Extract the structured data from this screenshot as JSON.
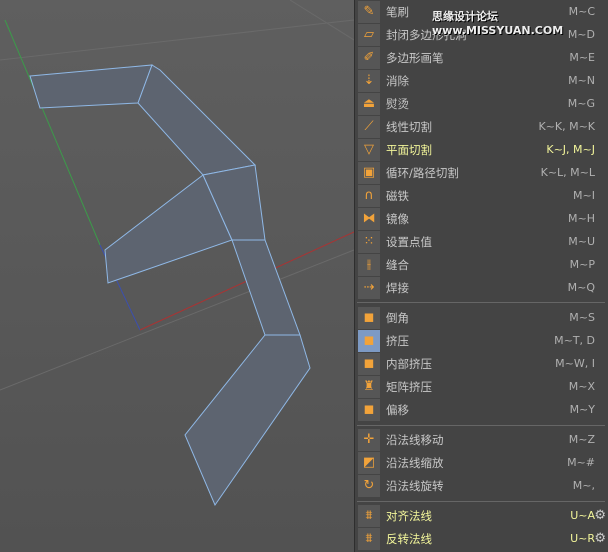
{
  "watermark": "思缘设计论坛 www.MISSYUAN.COM",
  "menu": {
    "group1": [
      {
        "icon": "brush-icon",
        "glyph": "✎",
        "label": "笔刷",
        "shortcut": "M~C"
      },
      {
        "icon": "close-polygon-hole-icon",
        "glyph": "▱",
        "label": "封闭多边形孔洞",
        "shortcut": "M~D"
      },
      {
        "icon": "polygon-pen-icon",
        "glyph": "✐",
        "label": "多边形画笔",
        "shortcut": "M~E"
      },
      {
        "icon": "dissolve-icon",
        "glyph": "⇣",
        "label": "消除",
        "shortcut": "M~N"
      },
      {
        "icon": "iron-icon",
        "glyph": "⏏",
        "label": "熨烫",
        "shortcut": "M~G"
      },
      {
        "icon": "knife-icon",
        "glyph": "⟋",
        "label": "线性切割",
        "shortcut": "K~K, M~K"
      },
      {
        "icon": "plane-cut-icon",
        "glyph": "▽",
        "label": "平面切割",
        "shortcut": "K~J, M~J",
        "highlight": true
      },
      {
        "icon": "loop-cut-icon",
        "glyph": "▣",
        "label": "循环/路径切割",
        "shortcut": "K~L, M~L"
      },
      {
        "icon": "magnet-icon",
        "glyph": "∩",
        "label": "磁铁",
        "shortcut": "M~I"
      },
      {
        "icon": "mirror-icon",
        "glyph": "⧓",
        "label": "镜像",
        "shortcut": "M~H"
      },
      {
        "icon": "set-point-value-icon",
        "glyph": "⁙",
        "label": "设置点值",
        "shortcut": "M~U"
      },
      {
        "icon": "stitch-icon",
        "glyph": "⫲",
        "label": "缝合",
        "shortcut": "M~P"
      },
      {
        "icon": "weld-icon",
        "glyph": "⇢",
        "label": "焊接",
        "shortcut": "M~Q"
      }
    ],
    "group2": [
      {
        "icon": "bevel-icon",
        "glyph": "◼",
        "label": "倒角",
        "shortcut": "M~S"
      },
      {
        "icon": "extrude-icon",
        "glyph": "◼",
        "label": "挤压",
        "shortcut": "M~T, D",
        "selected": true
      },
      {
        "icon": "inner-extrude-icon",
        "glyph": "◼",
        "label": "内部挤压",
        "shortcut": "M~W, I"
      },
      {
        "icon": "matrix-extrude-icon",
        "glyph": "♜",
        "label": "矩阵挤压",
        "shortcut": "M~X"
      },
      {
        "icon": "offset-icon",
        "glyph": "◼",
        "label": "偏移",
        "shortcut": "M~Y"
      }
    ],
    "group3": [
      {
        "icon": "normal-move-icon",
        "glyph": "✛",
        "label": "沿法线移动",
        "shortcut": "M~Z"
      },
      {
        "icon": "normal-scale-icon",
        "glyph": "◩",
        "label": "沿法线缩放",
        "shortcut": "M~#"
      },
      {
        "icon": "normal-rotate-icon",
        "glyph": "↻",
        "label": "沿法线旋转",
        "shortcut": "M~,"
      }
    ],
    "group4": [
      {
        "icon": "align-normals-icon",
        "glyph": "⩩",
        "label": "对齐法线",
        "shortcut": "U~A",
        "highlight": true
      },
      {
        "icon": "reverse-normals-icon",
        "glyph": "⩩",
        "label": "反转法线",
        "shortcut": "U~R",
        "highlight": true
      }
    ]
  }
}
